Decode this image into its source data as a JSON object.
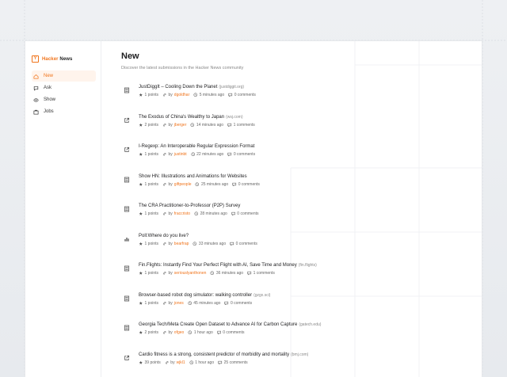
{
  "brand": {
    "name_prefix": "Hacker",
    "name_suffix": " News",
    "logo_glyph": "Y",
    "accent": "#f0731a"
  },
  "nav": [
    {
      "label": "New",
      "icon": "home-icon",
      "active": true
    },
    {
      "label": "Ask",
      "icon": "chat-icon",
      "active": false
    },
    {
      "label": "Show",
      "icon": "eye-icon",
      "active": false
    },
    {
      "label": "Jobs",
      "icon": "briefcase-icon",
      "active": false
    }
  ],
  "page": {
    "title": "New",
    "subtitle": "Discover the latest submissions in the Hacker News community"
  },
  "meta_labels": {
    "by": "by"
  },
  "stories": [
    {
      "icon": "document-icon",
      "title": "JustDiggIt – Cooling Down the Planet",
      "domain": "(justdiggit.org)",
      "points": "1 points",
      "author": "dgoldhar",
      "time": "5 minutes ago",
      "comments": "0 comments"
    },
    {
      "icon": "external-link-icon",
      "title": "The Exodus of China's Wealthy to Japan",
      "domain": "(wsj.com)",
      "points": "2 points",
      "author": "jberger",
      "time": "14 minutes ago",
      "comments": "1 comments"
    },
    {
      "icon": "external-link-icon",
      "title": "I-Regexp: An Interoperable Regular Expression Format",
      "domain": "",
      "points": "1 points",
      "author": "justinbt",
      "time": "22 minutes ago",
      "comments": "0 comments"
    },
    {
      "icon": "document-icon",
      "title": "Show HN: Illustrations and Animations for Websites",
      "domain": "",
      "points": "1 points",
      "author": "giftpeople",
      "time": "25 minutes ago",
      "comments": "0 comments"
    },
    {
      "icon": "document-icon",
      "title": "The CRA Practitioner-to-Professor (P2P) Survey",
      "domain": "",
      "points": "1 points",
      "author": "fraccristo",
      "time": "28 minutes ago",
      "comments": "0 comments"
    },
    {
      "icon": "bar-chart-icon",
      "title": "Poll:Where do you live?",
      "domain": "",
      "points": "1 points",
      "author": "bearfrap",
      "time": "33 minutes ago",
      "comments": "0 comments"
    },
    {
      "icon": "document-icon",
      "title": "Fin.Flights: Instantly Find Your Perfect Flight with AI, Save Time and Money",
      "domain": "(fin.flights)",
      "points": "1 points",
      "author": "seriouslyanthonen",
      "time": "36 minutes ago",
      "comments": "1 comments"
    },
    {
      "icon": "document-icon",
      "title": "Browser-based robot dog simulator: walking controller",
      "domain": "(gzgx.sci)",
      "points": "1 points",
      "author": "jones",
      "time": "45 minutes ago",
      "comments": "0 comments"
    },
    {
      "icon": "document-icon",
      "title": "Georgia Tech/Meta Create Open Dataset to Advance AI for Carbon Capture",
      "domain": "(gatech.edu)",
      "points": "2 points",
      "author": "ofgeo",
      "time": "1 hour ago",
      "comments": "0 comments"
    },
    {
      "icon": "external-link-icon",
      "title": "Cardio fitness is a strong, consistent predictor of morbidity and mortality",
      "domain": "(bmj.com)",
      "points": "39 points",
      "author": "wjkl1",
      "time": "1 hour ago",
      "comments": "25 comments"
    }
  ]
}
